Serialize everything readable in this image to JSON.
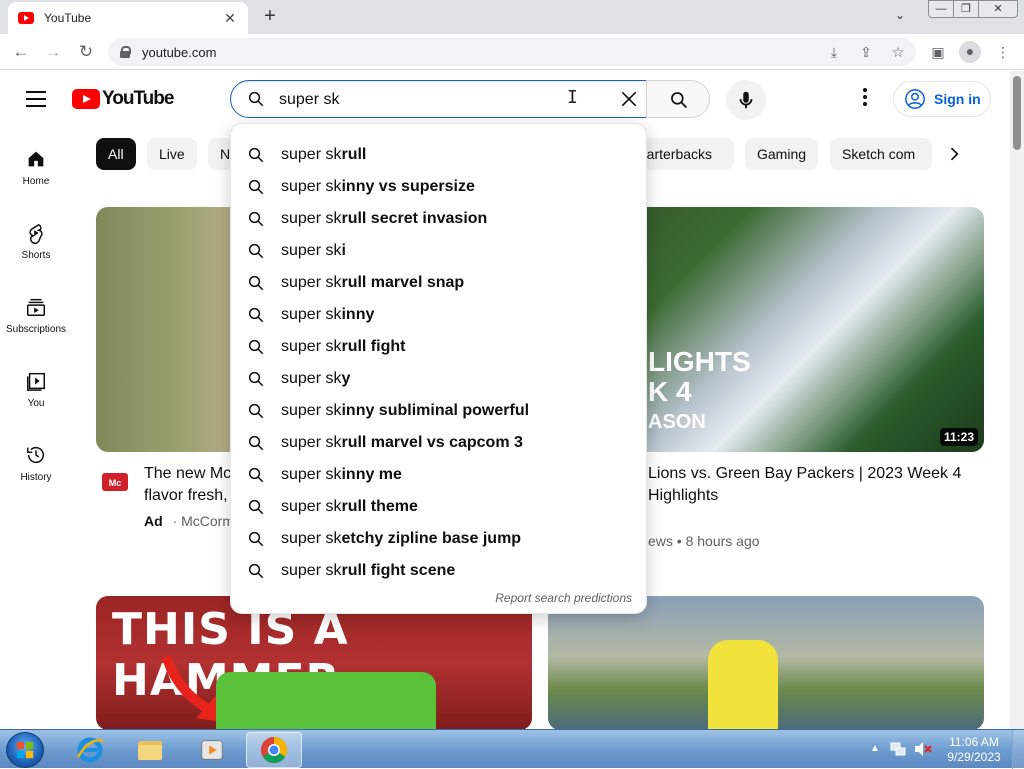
{
  "browser": {
    "tab_title": "YouTube",
    "url": "youtube.com"
  },
  "header": {
    "logo_text": "YouTube",
    "search_value": "super sk",
    "sign_in_label": "Sign in"
  },
  "sidebar": {
    "items": [
      {
        "label": "Home"
      },
      {
        "label": "Shorts"
      },
      {
        "label": "Subscriptions"
      },
      {
        "label": "You"
      },
      {
        "label": "History"
      }
    ]
  },
  "chips": {
    "all": "All",
    "live": "Live",
    "partial_left": "N",
    "quarterbacks": "Quarterbacks",
    "gaming": "Gaming",
    "sketch": "Sketch com"
  },
  "suggestions": {
    "prefix": "super sk",
    "items": [
      {
        "rest": "rull"
      },
      {
        "rest": "inny vs supersize"
      },
      {
        "rest": "rull secret invasion"
      },
      {
        "rest": "i"
      },
      {
        "rest": "rull marvel snap"
      },
      {
        "rest": "inny"
      },
      {
        "rest": "rull fight"
      },
      {
        "rest": "y"
      },
      {
        "rest": "inny subliminal powerful"
      },
      {
        "rest": "rull marvel vs capcom 3"
      },
      {
        "rest": "inny me"
      },
      {
        "rest": "rull theme"
      },
      {
        "rest": "etchy zipline base jump"
      },
      {
        "rest": "rull fight scene"
      }
    ],
    "report_link": "Report search predictions"
  },
  "videos": {
    "ad_title_line1": "The new Mc",
    "ad_title_line2": "flavor fresh,",
    "ad_tag": "Ad",
    "ad_channel": "McCormi",
    "v2_title_line1": "Lions vs. Green Bay Packers | 2023 Week 4",
    "v2_title_line2": "Highlights",
    "v2_meta": "ews • 8 hours ago",
    "v2_duration": "11:23",
    "v2_overlay_line1": "LIGHTS",
    "v2_overlay_line2": "K 4",
    "v2_overlay_line3": "ASON",
    "v3_overlay": "THIS IS A HAMMER"
  },
  "taskbar": {
    "time": "11:06 AM",
    "date": "9/29/2023"
  },
  "colors": {
    "yt_red": "#ff0000",
    "link_blue": "#065fd4",
    "search_border": "#1c62b9"
  }
}
